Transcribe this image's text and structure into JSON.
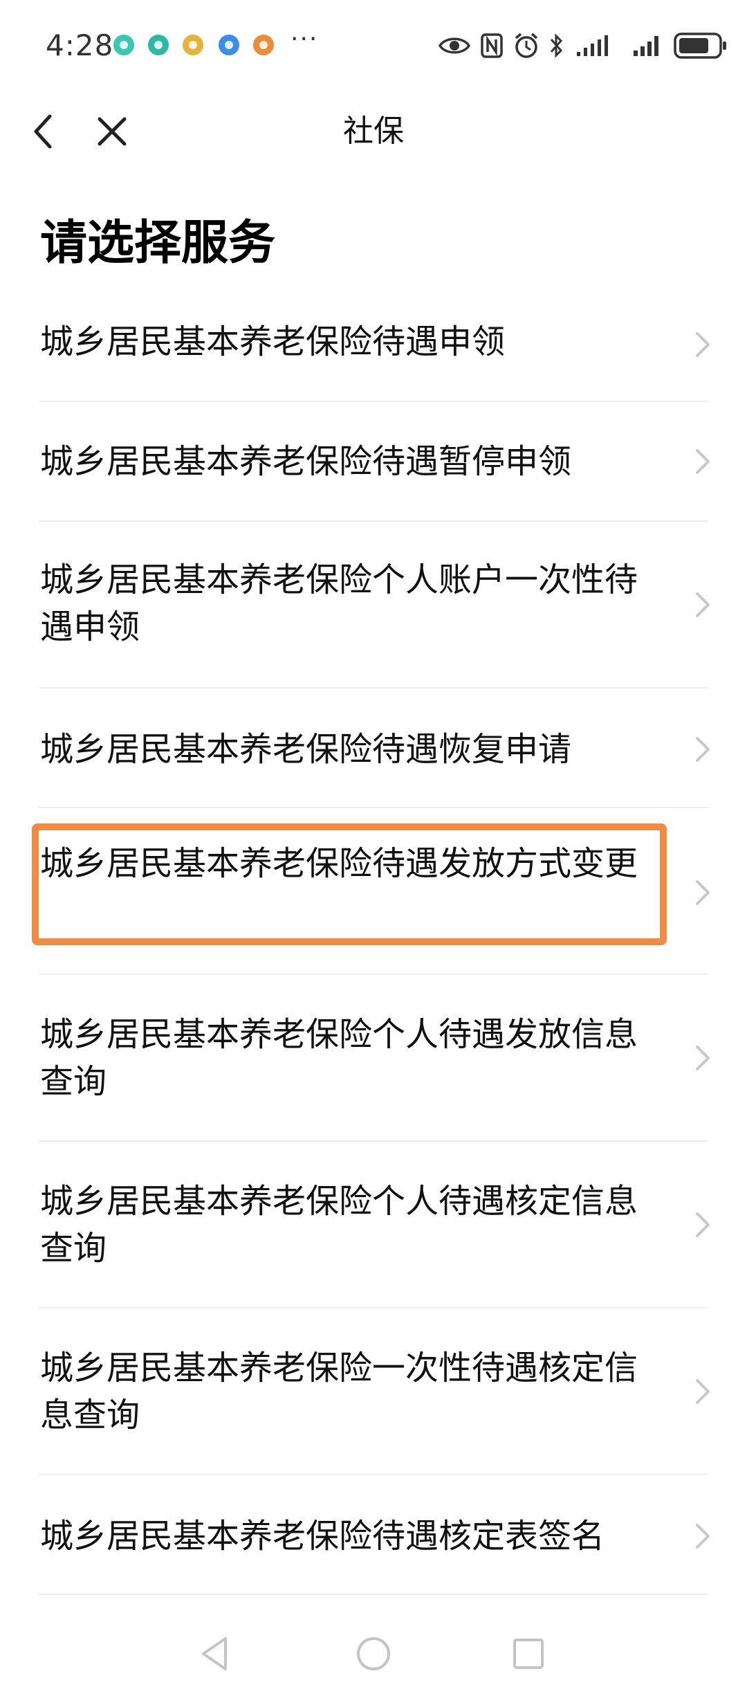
{
  "status_bar": {
    "time": "4:28",
    "more_indicator": "···",
    "notification_icons": [
      {
        "name": "app-notification-icon-1",
        "color": "#3cc7b2"
      },
      {
        "name": "app-notification-icon-2",
        "color": "#2fb9a4"
      },
      {
        "name": "app-notification-icon-3",
        "color": "#e3b33c"
      },
      {
        "name": "app-notification-icon-4",
        "color": "#3a8ee6"
      },
      {
        "name": "app-notification-icon-5",
        "color": "#e88d3a"
      }
    ],
    "battery_level": 0.7
  },
  "nav": {
    "title": "社保",
    "back_icon": "chevron-left-icon",
    "close_icon": "close-icon"
  },
  "heading": "请选择服务",
  "services": [
    {
      "label": "城乡居民基本养老保险待遇申领"
    },
    {
      "label": "城乡居民基本养老保险待遇暂停申领"
    },
    {
      "label": "城乡居民基本养老保险个人账户一次性待遇申领"
    },
    {
      "label": "城乡居民基本养老保险待遇恢复申请"
    },
    {
      "label": "城乡居民基本养老保险待遇发放方式变更",
      "highlighted": true
    },
    {
      "label": "城乡居民基本养老保险个人待遇发放信息查询"
    },
    {
      "label": "城乡居民基本养老保险个人待遇核定信息查询"
    },
    {
      "label": "城乡居民基本养老保险一次性待遇核定信息查询"
    },
    {
      "label": "城乡居民基本养老保险待遇核定表签名"
    }
  ],
  "colors": {
    "highlight": "#ee8c45",
    "divider": "#eeeeee",
    "chevron": "#c8c8c8"
  }
}
